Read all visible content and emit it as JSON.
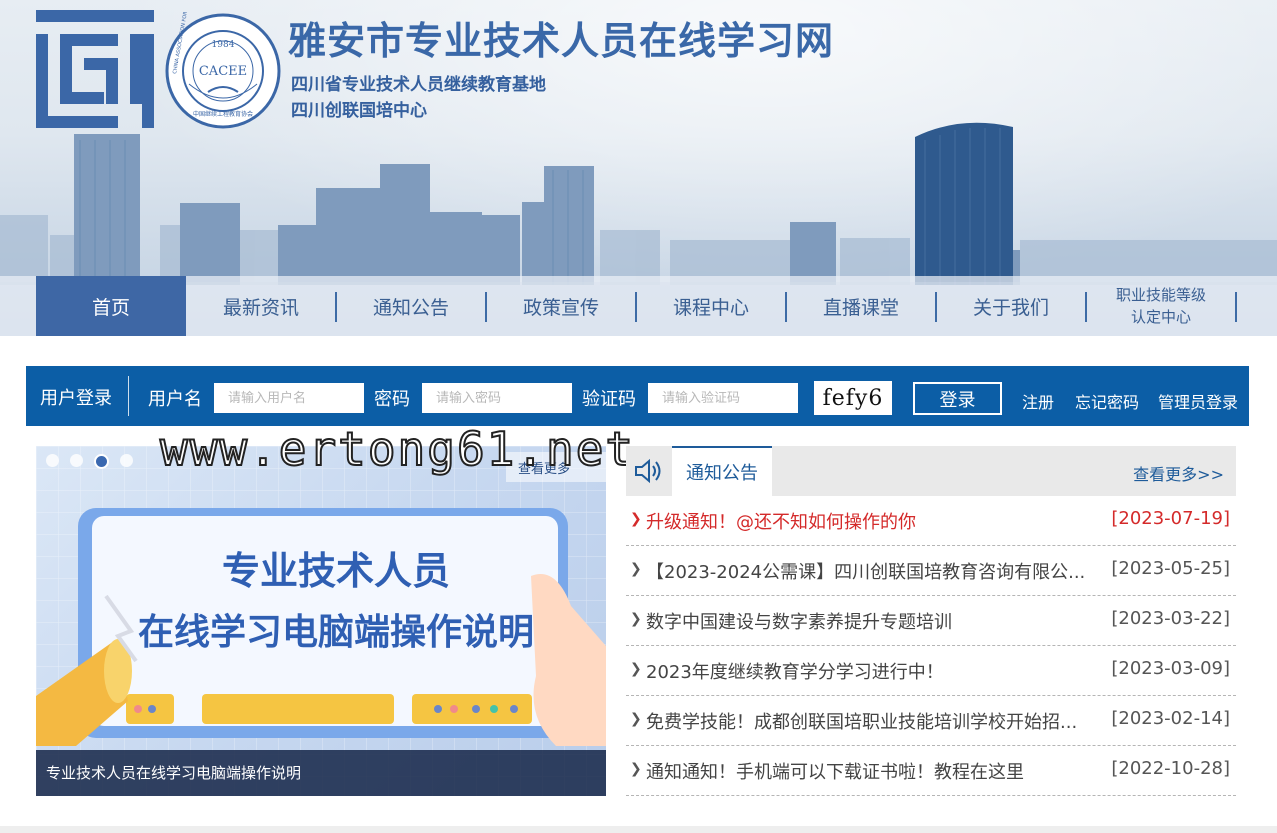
{
  "header": {
    "title": "雅安市专业技术人员在线学习网",
    "subtitle1": "四川省专业技术人员继续教育基地",
    "subtitle2": "四川创联国培中心",
    "seal": {
      "ring_text": "CHINA ASSOCIATION FOR CONTINUING ENGINEERING EDUCATION",
      "year": "1984",
      "abbr": "CACEE",
      "cn_text": "中国继续工程教育协会"
    }
  },
  "nav": {
    "items": [
      {
        "label": "首页",
        "active": true
      },
      {
        "label": "最新资讯"
      },
      {
        "label": "通知公告"
      },
      {
        "label": "政策宣传"
      },
      {
        "label": "课程中心"
      },
      {
        "label": "直播课堂"
      },
      {
        "label": "关于我们"
      },
      {
        "label_line1": "职业技能等级",
        "label_line2": "认定中心"
      }
    ]
  },
  "login": {
    "title": "用户登录",
    "username_label": "用户名",
    "username_placeholder": "请输入用户名",
    "password_label": "密码",
    "password_placeholder": "请输入密码",
    "captcha_label": "验证码",
    "captcha_placeholder": "请输入验证码",
    "captcha_text": "fefy6",
    "login_button": "登录",
    "register": "注册",
    "forgot": "忘记密码",
    "admin": "管理员登录"
  },
  "carousel": {
    "more": "查看更多",
    "headline1": "专业技术人员",
    "headline2": "在线学习电脑端操作说明",
    "caption": "专业技术人员在线学习电脑端操作说明",
    "active_slide": 3,
    "slide_count": 4
  },
  "watermark": "www.ertong61.net",
  "notices": {
    "tab": "通知公告",
    "more": "查看更多>>",
    "items": [
      {
        "title": "升级通知！@还不知如何操作的你",
        "date": "[2023-07-19]",
        "hot": true
      },
      {
        "title": "【2023-2024公需课】四川创联国培教育咨询有限公...",
        "date": "[2023-05-25]"
      },
      {
        "title": "数字中国建设与数字素养提升专题培训",
        "date": "[2023-03-22]"
      },
      {
        "title": "2023年度继续教育学分学习进行中！",
        "date": "[2023-03-09]"
      },
      {
        "title": "免费学技能！成都创联国培职业技能培训学校开始招...",
        "date": "[2023-02-14]"
      },
      {
        "title": "通知通知！手机端可以下载证书啦！教程在这里",
        "date": "[2022-10-28]"
      }
    ]
  },
  "colors": {
    "brand_blue": "#3a68a8",
    "login_bar": "#0c5ea6",
    "nav_active": "#3e67a5",
    "hot_red": "#d42a2a"
  }
}
